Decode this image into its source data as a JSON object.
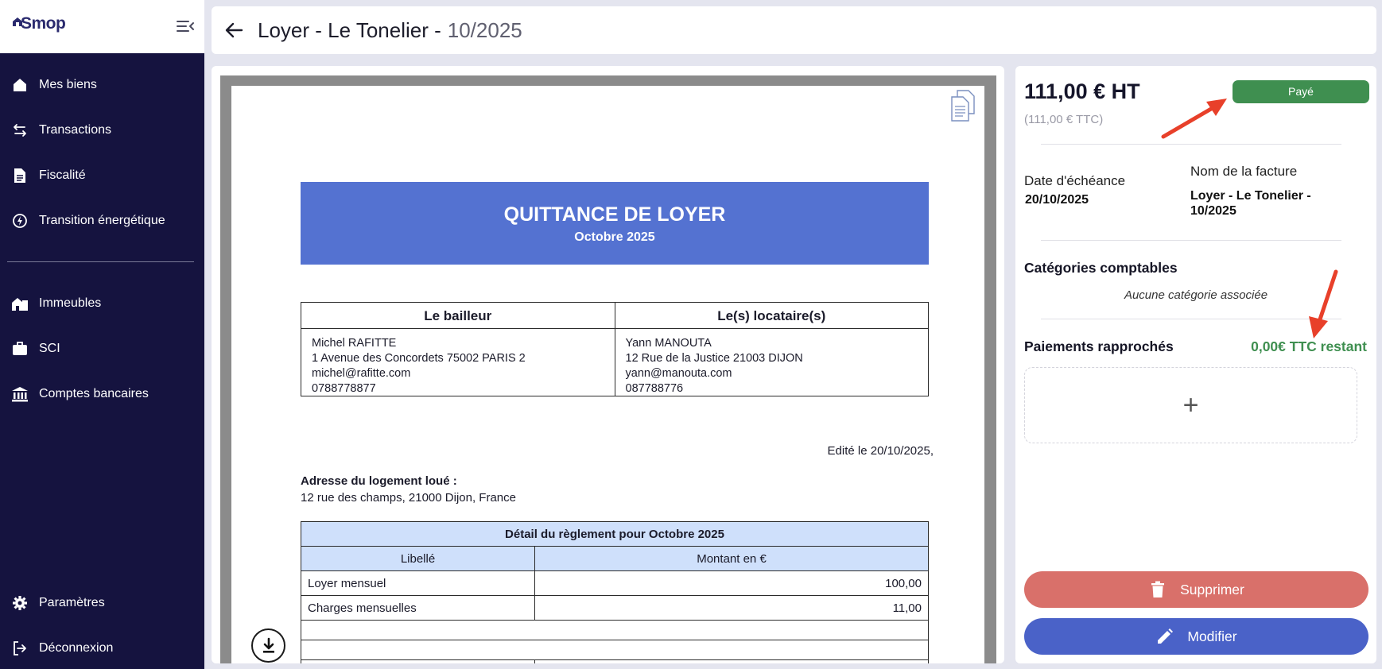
{
  "app": {
    "logo_text": "Smop"
  },
  "sidebar": {
    "items": [
      {
        "label": "Mes biens",
        "icon": "home-icon"
      },
      {
        "label": "Transactions",
        "icon": "swap-arrows-icon"
      },
      {
        "label": "Fiscalité",
        "icon": "document-icon"
      },
      {
        "label": "Transition énergétique",
        "icon": "energy-icon"
      },
      {
        "label": "Immeubles",
        "icon": "buildings-icon"
      },
      {
        "label": "SCI",
        "icon": "briefcase-icon"
      },
      {
        "label": "Comptes bancaires",
        "icon": "bank-icon"
      },
      {
        "label": "Paramètres",
        "icon": "gear-icon"
      },
      {
        "label": "Déconnexion",
        "icon": "logout-icon"
      }
    ]
  },
  "header": {
    "title": "Loyer - Le Tonelier -",
    "period": "10/2025"
  },
  "document": {
    "banner_title": "QUITTANCE DE LOYER",
    "banner_subtitle": "Octobre 2025",
    "landlord": {
      "heading": "Le bailleur",
      "lines": [
        "Michel RAFITTE",
        "1 Avenue des Concordets 75002 PARIS 2",
        "michel@rafitte.com",
        "0788778877"
      ]
    },
    "tenant": {
      "heading": "Le(s) locataire(s)",
      "lines": [
        "Yann MANOUTA",
        "12 Rue de la Justice 21003 DIJON",
        "yann@manouta.com",
        "087788776"
      ]
    },
    "edited": "Edité le 20/10/2025,",
    "address_label": "Adresse du logement loué :",
    "address_value": "12 rue des champs, 21000 Dijon, France",
    "table": {
      "caption": "Détail du règlement pour Octobre 2025",
      "col_label": "Libellé",
      "col_amount": "Montant en €",
      "rows": [
        {
          "label": "Loyer mensuel",
          "amount": "100,00"
        },
        {
          "label": "Charges mensuelles",
          "amount": "11,00"
        }
      ]
    }
  },
  "details": {
    "amount_ht": "111,00 € HT",
    "amount_ttc": "(111,00 € TTC)",
    "status": "Payé",
    "status_color": "#3f8f50",
    "due_date_label": "Date d'échéance",
    "due_date_value": "20/10/2025",
    "invoice_name_label": "Nom de la facture",
    "invoice_name_line1": "Loyer - Le Tonelier -",
    "invoice_name_line2": "10/2025",
    "categories_title": "Catégories comptables",
    "categories_empty": "Aucune catégorie associée",
    "payments_title": "Paiements rapprochés",
    "payments_remaining": "0,00€ TTC restant",
    "add_symbol": "+",
    "delete_label": "Supprimer",
    "edit_label": "Modifier",
    "delete_color": "#d9706a",
    "edit_color": "#4a62c8"
  }
}
